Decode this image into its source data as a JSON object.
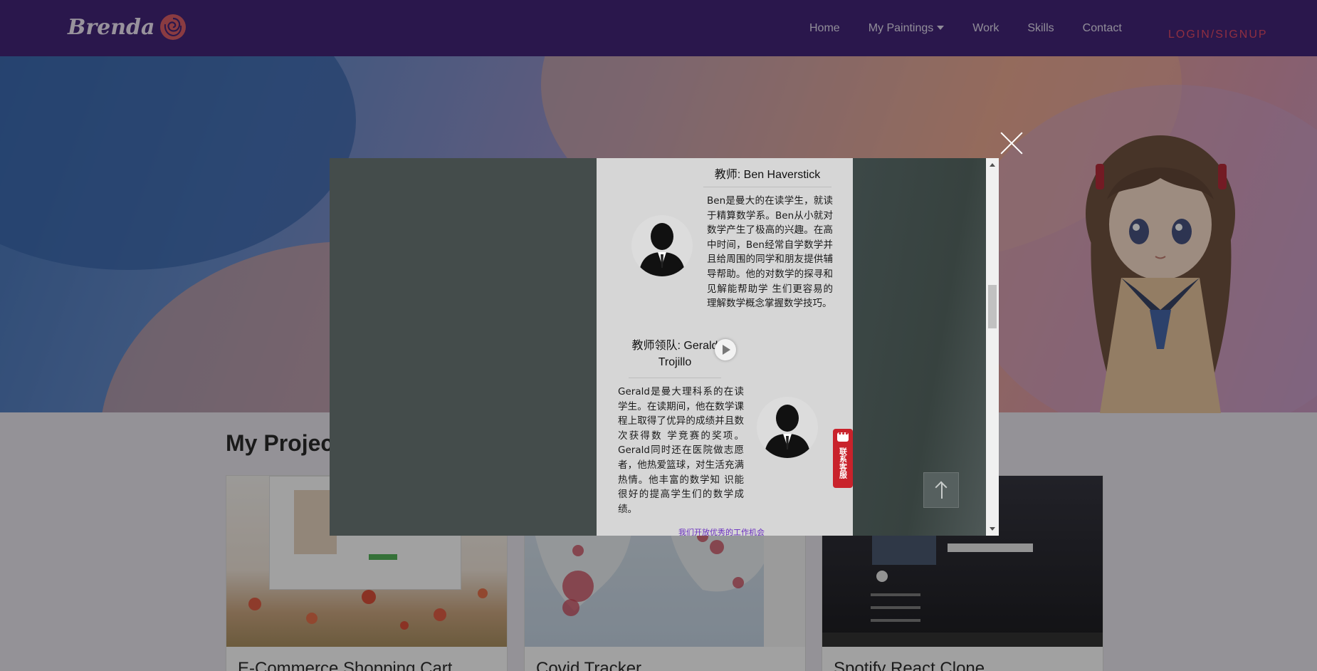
{
  "nav": {
    "brand": "Brenda",
    "links": [
      {
        "label": "Home"
      },
      {
        "label": "My Paintings"
      },
      {
        "label": "Work"
      },
      {
        "label": "Skills"
      },
      {
        "label": "Contact"
      }
    ],
    "login": "LOGIN/SIGNUP"
  },
  "section": {
    "title": "My Projects",
    "projects": [
      {
        "title": "E-Commerce Shopping Cart"
      },
      {
        "title": "Covid Tracker"
      },
      {
        "title": "Spotify React Clone"
      }
    ]
  },
  "modal": {
    "teacher1": {
      "name": "教师: Ben Haverstick",
      "bio": "Ben是曼大的在读学生，就读于精算数学系。Ben从小就对数学产生了极高的兴趣。在高中时间，Ben经常自学数学并且给周围的同学和朋友提供辅导帮助。他的对数学的探寻和见解能帮助学 生们更容易的理解数学概念掌握数学技巧。"
    },
    "teacher2": {
      "name_line1": "教师领队: Gerald",
      "name_line2": "Trojillo",
      "bio": "Gerald是曼大理科系的在读学生。在读期间，他在数学课程上取得了优异的成绩并且数次获得数 学竞赛的奖项。Gerald同时还在医院做志愿者，他热爱篮球，对生活充满热情。他丰富的数学知 识能很好的提高学生们的数学成绩。"
    },
    "jobs_link": "我们开放优秀的工作机会",
    "support_label": "联系客服"
  },
  "colors": {
    "nav_bg": "#3a1a72",
    "login": "#e0405f",
    "support": "#c9222b"
  }
}
